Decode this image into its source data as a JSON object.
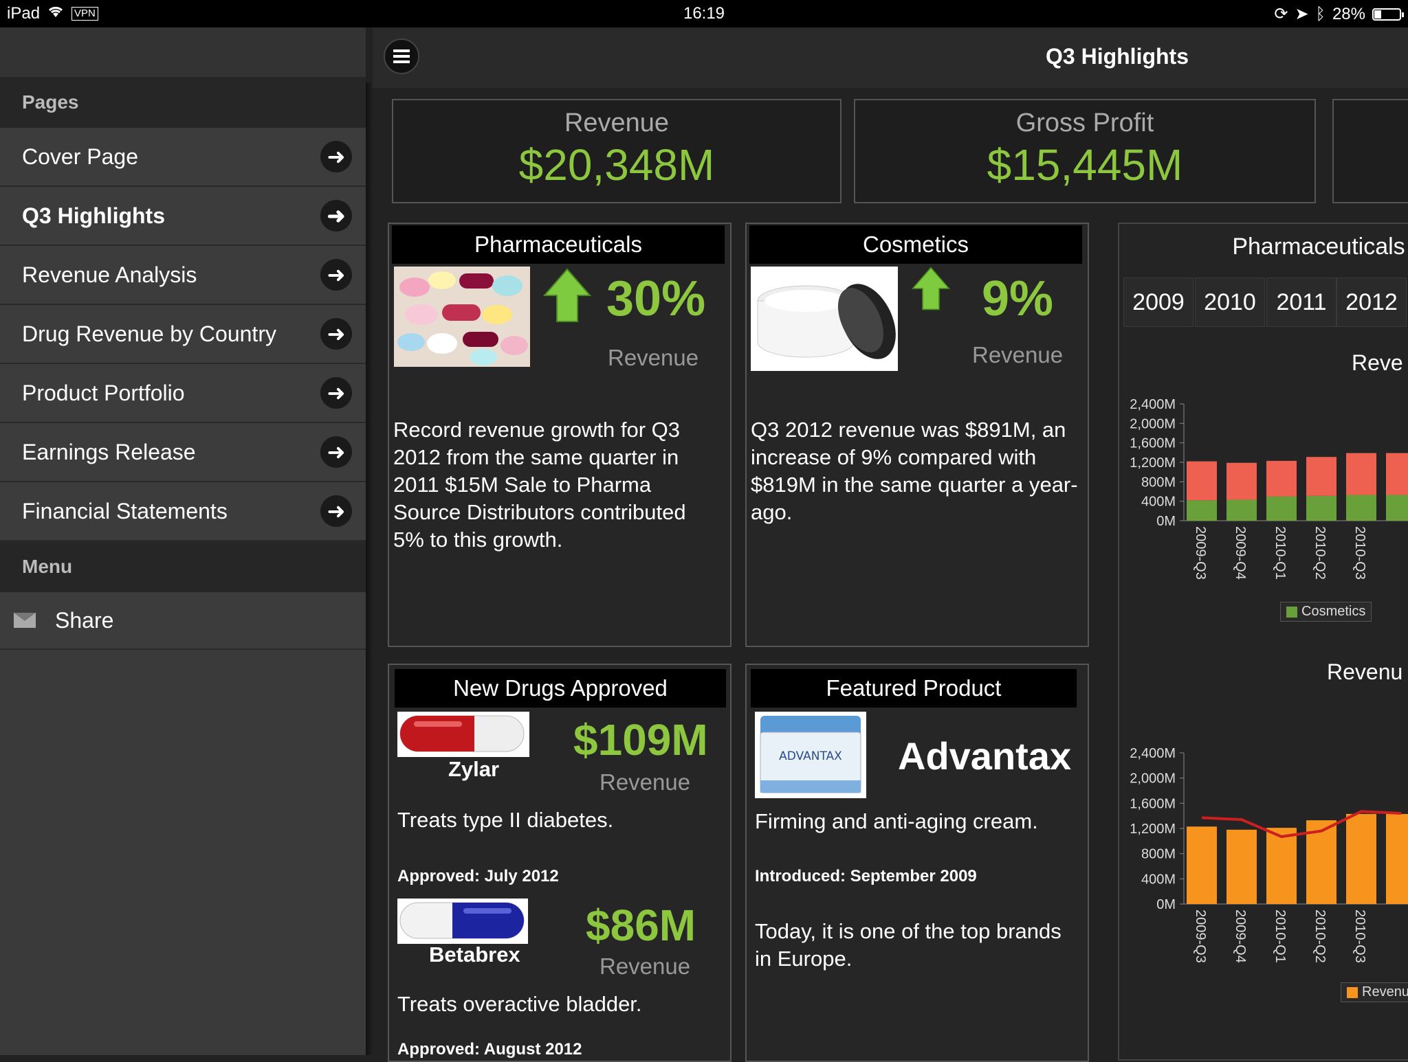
{
  "status_bar": {
    "device": "iPad",
    "vpn": "VPN",
    "time": "16:19",
    "battery": "28%"
  },
  "sidebar": {
    "pages_header": "Pages",
    "items": [
      {
        "label": "Cover Page"
      },
      {
        "label": "Q3 Highlights"
      },
      {
        "label": "Revenue Analysis"
      },
      {
        "label": "Drug Revenue by Country"
      },
      {
        "label": "Product Portfolio"
      },
      {
        "label": "Earnings Release"
      },
      {
        "label": "Financial Statements"
      }
    ],
    "menu_header": "Menu",
    "share_label": "Share"
  },
  "header": {
    "title": "Q3 Highlights"
  },
  "kpis": [
    {
      "label": "Revenue",
      "value": "$20,348M"
    },
    {
      "label": "Gross Profit",
      "value": "$15,445M"
    }
  ],
  "cards": {
    "pharma": {
      "title": "Pharmaceuticals",
      "pct": "30%",
      "sublabel": "Revenue",
      "text": "Record revenue growth for Q3 2012 from the same quarter in 2011 $15M Sale to Pharma Source Distributors contributed 5% to this growth."
    },
    "cosmetics": {
      "title": "Cosmetics",
      "pct": "9%",
      "sublabel": "Revenue",
      "text": "Q3 2012 revenue was $891M, an increase of 9% compared with $819M in the same quarter a year-ago."
    },
    "new_drugs": {
      "title": "New Drugs Approved",
      "drug1": {
        "name": "Zylar",
        "value": "$109M",
        "sublabel": "Revenue",
        "desc": "Treats type II diabetes.",
        "approved": "Approved: July 2012"
      },
      "drug2": {
        "name": "Betabrex",
        "value": "$86M",
        "sublabel": "Revenue",
        "desc": "Treats overactive bladder.",
        "approved": "Approved: August 2012"
      }
    },
    "featured": {
      "title": "Featured Product",
      "name": "Advantax",
      "jar_label": "ADVANTAX",
      "desc": "Firming and anti-aging cream.",
      "introduced": "Introduced: September 2009",
      "text": "Today, it is one of the top brands in Europe."
    }
  },
  "right_panel": {
    "title": "Pharmaceuticals",
    "year_tabs": [
      "2009",
      "2010",
      "2011",
      "2012"
    ],
    "chart1_title": "Reve",
    "chart2_title": "Revenu",
    "legend1": "Cosmetics",
    "legend2": "Revenu"
  },
  "chart_data": [
    {
      "type": "bar",
      "title": "Reve",
      "categories": [
        "2009-Q3",
        "2009-Q4",
        "2010-Q1",
        "2010-Q2",
        "2010-Q3"
      ],
      "y_ticks": [
        "2,400M",
        "2,000M",
        "1,600M",
        "1,200M",
        "800M",
        "400M",
        "0M"
      ],
      "ylim": [
        0,
        2400
      ],
      "stacked": true,
      "series": [
        {
          "name": "Cosmetics",
          "color": "#6aa039",
          "values": [
            420,
            430,
            500,
            510,
            530
          ]
        },
        {
          "color": "#ee6150",
          "values": [
            800,
            760,
            730,
            800,
            860
          ]
        }
      ],
      "legend": "bottom"
    },
    {
      "type": "bar",
      "title": "Revenu",
      "categories": [
        "2009-Q3",
        "2009-Q4",
        "2010-Q1",
        "2010-Q2",
        "2010-Q3"
      ],
      "y_ticks": [
        "2,400M",
        "2,000M",
        "1,600M",
        "1,200M",
        "800M",
        "400M",
        "0M"
      ],
      "ylim": [
        0,
        2400
      ],
      "series": [
        {
          "name": "Revenu",
          "color": "#f7941d",
          "values": [
            1230,
            1180,
            1210,
            1330,
            1430
          ]
        },
        {
          "color": "#cc1f1f",
          "type": "line",
          "values": [
            1370,
            1340,
            1070,
            1160,
            1470
          ]
        }
      ],
      "legend": "bottom"
    }
  ]
}
